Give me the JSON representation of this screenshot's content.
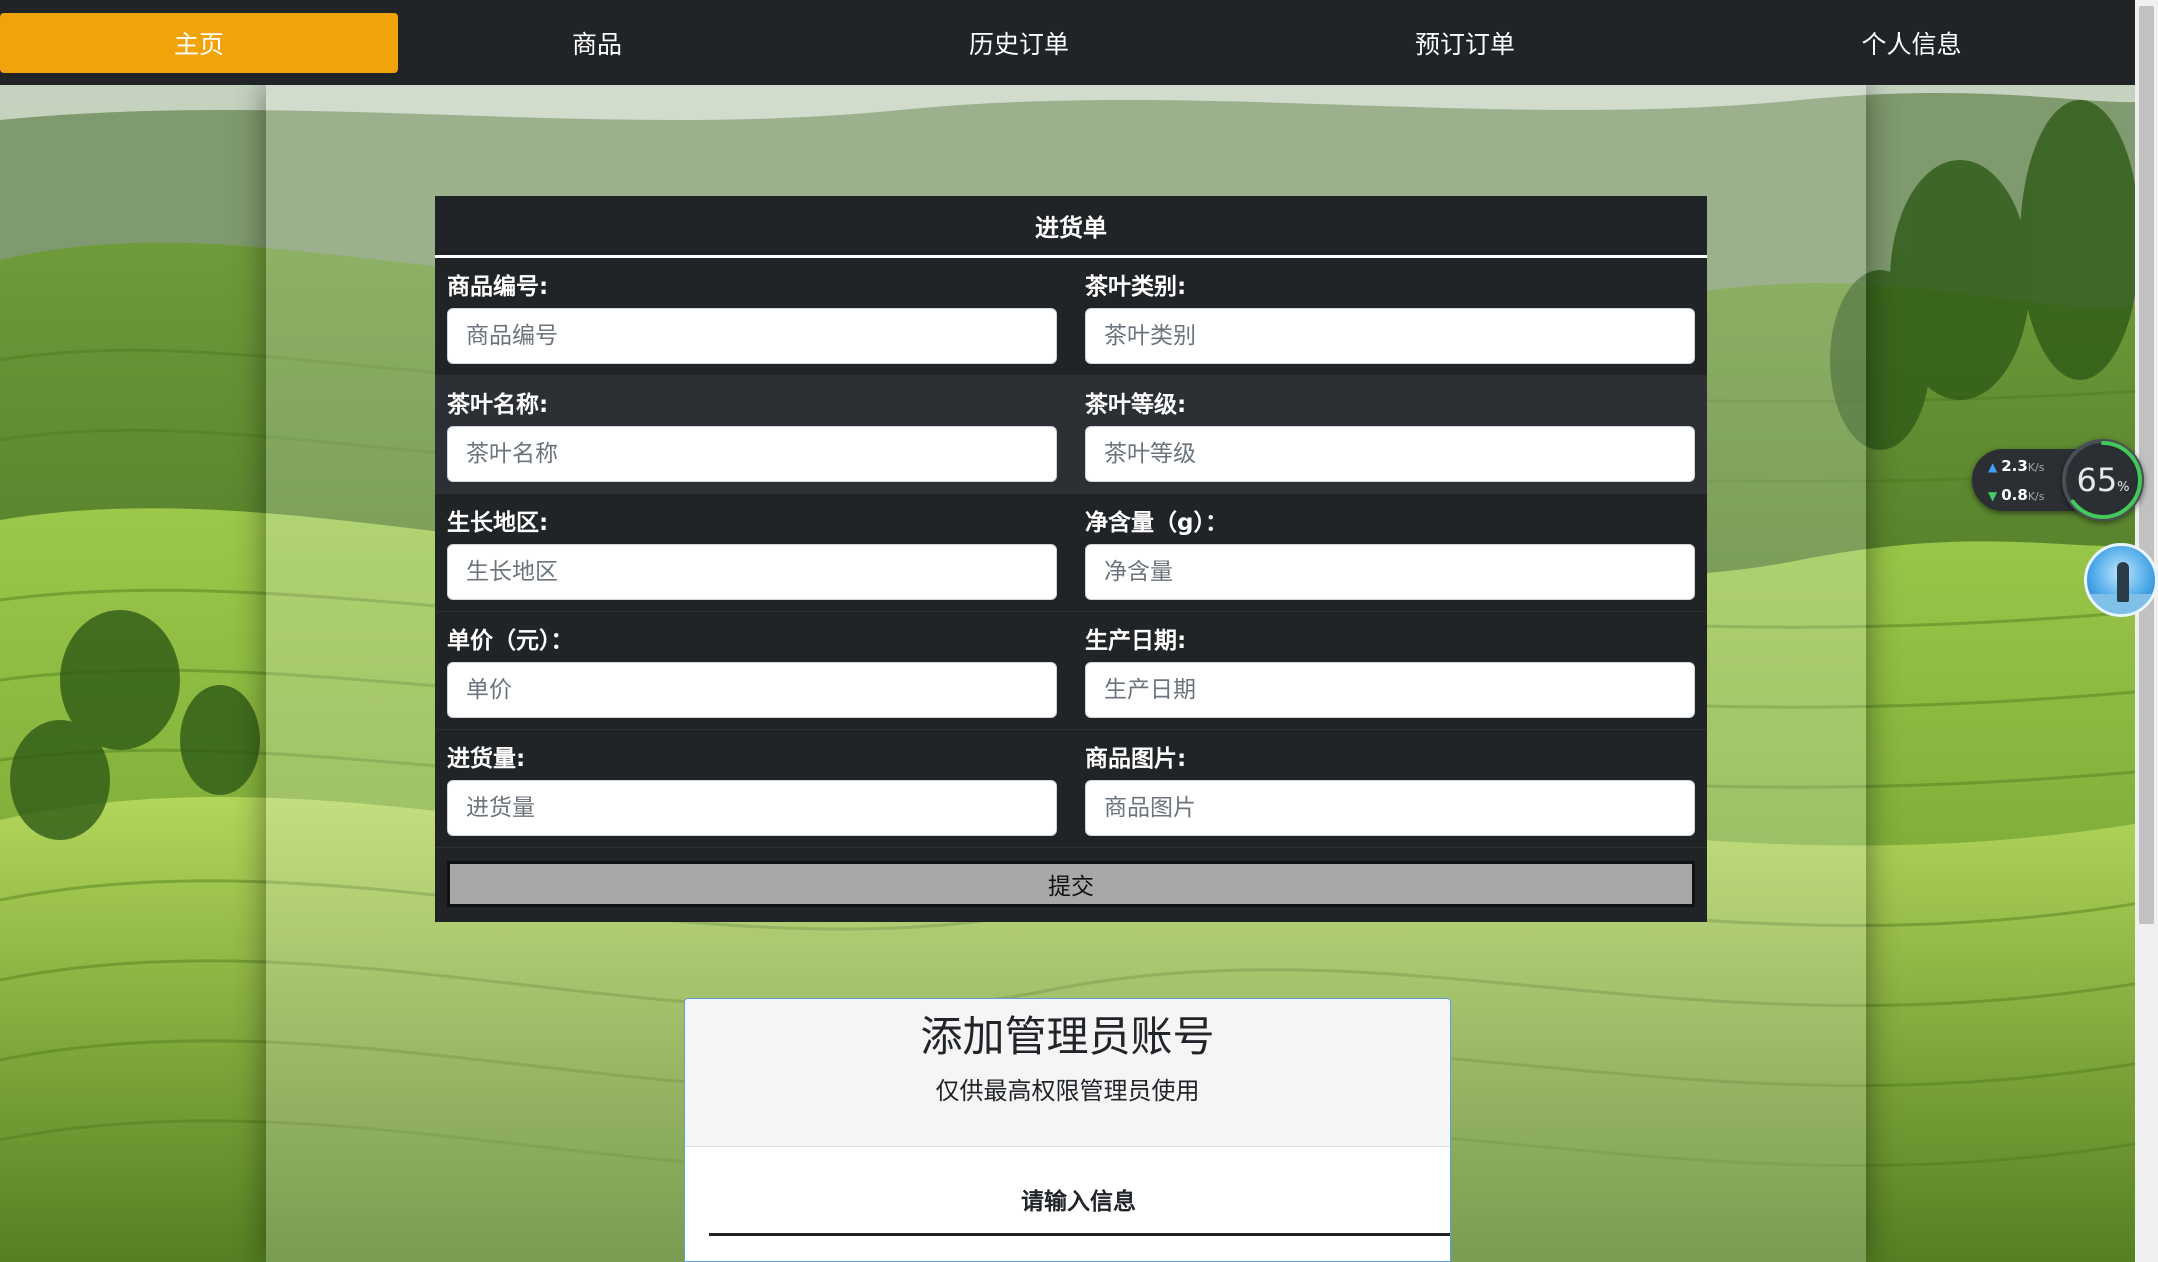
{
  "nav": {
    "items": [
      {
        "label": "主页",
        "active": true
      },
      {
        "label": "商品",
        "active": false
      },
      {
        "label": "历史订单",
        "active": false
      },
      {
        "label": "预订订单",
        "active": false
      },
      {
        "label": "个人信息",
        "active": false
      }
    ],
    "active_color": "#f0a30a",
    "bar_color": "#212427"
  },
  "stock_form": {
    "title": "进货单",
    "fields": {
      "product_id": {
        "label": "商品编号:",
        "placeholder": "商品编号",
        "value": ""
      },
      "tea_category": {
        "label": "茶叶类别:",
        "placeholder": "茶叶类别",
        "value": ""
      },
      "tea_name": {
        "label": "茶叶名称:",
        "placeholder": "茶叶名称",
        "value": ""
      },
      "tea_grade": {
        "label": "茶叶等级:",
        "placeholder": "茶叶等级",
        "value": ""
      },
      "origin": {
        "label": "生长地区:",
        "placeholder": "生长地区",
        "value": ""
      },
      "net_weight": {
        "label": "净含量（g）：",
        "placeholder": "净含量",
        "value": ""
      },
      "unit_price": {
        "label": "单价（元）：",
        "placeholder": "单价",
        "value": ""
      },
      "production_date": {
        "label": "生产日期:",
        "placeholder": "生产日期",
        "value": ""
      },
      "quantity": {
        "label": "进货量:",
        "placeholder": "进货量",
        "value": ""
      },
      "product_image": {
        "label": "商品图片:",
        "placeholder": "商品图片",
        "value": ""
      }
    },
    "submit_label": "提交"
  },
  "admin_card": {
    "title": "添加管理员账号",
    "subtitle": "仅供最高权限管理员使用",
    "section_label": "请输入信息"
  },
  "widgets": {
    "upload_speed": "2.3",
    "download_speed": "0.8",
    "speed_unit": "K/s",
    "usage_value": "65",
    "usage_unit": "%",
    "usage_fraction": 0.65
  }
}
